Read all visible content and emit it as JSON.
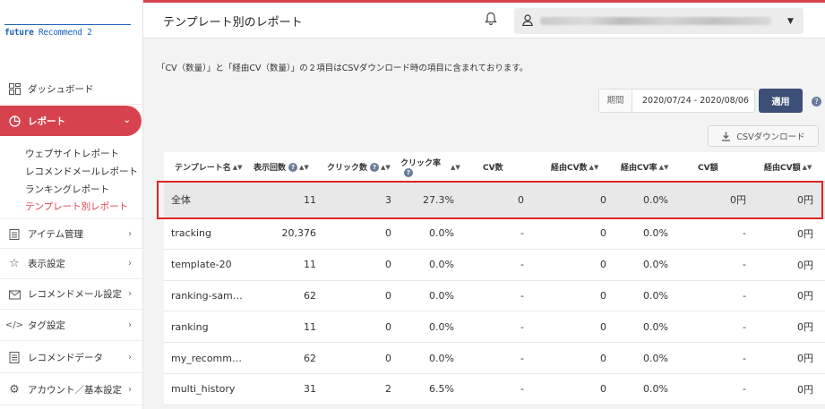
{
  "app": {
    "logo_brand": "future",
    "logo_product": "Recommend 2"
  },
  "sidebar": {
    "items": [
      {
        "label": "ダッシュボード"
      },
      {
        "label": "レポート"
      },
      {
        "label": "アイテム管理"
      },
      {
        "label": "表示設定"
      },
      {
        "label": "レコメンドメール設定"
      },
      {
        "label": "タグ設定"
      },
      {
        "label": "レコメンドデータ"
      },
      {
        "label": "アカウント／基本設定"
      }
    ],
    "report_sub": [
      {
        "label": "ウェブサイトレポート"
      },
      {
        "label": "レコメンドメールレポート"
      },
      {
        "label": "ランキングレポート"
      },
      {
        "label": "テンプレート別レポート"
      }
    ]
  },
  "header": {
    "title": "テンプレート別のレポート"
  },
  "notice": "「CV（数量）」と「経由CV（数量）」の２項目はCSVダウンロード時の項目に含まれております。",
  "filter": {
    "period_label": "期間",
    "period_value": "2020/07/24 - 2020/08/06",
    "apply_label": "適用"
  },
  "csv": {
    "label": "CSVダウンロード"
  },
  "table": {
    "columns": [
      "テンプレート名",
      "表示回数",
      "クリック数",
      "クリック率",
      "CV数",
      "経由CV数",
      "経由CV率",
      "CV額",
      "経由CV額"
    ],
    "rows": [
      [
        "全体",
        "11",
        "3",
        "27.3%",
        "0",
        "0",
        "0.0%",
        "0円",
        "0円"
      ],
      [
        "tracking",
        "20,376",
        "0",
        "0.0%",
        "-",
        "0",
        "0.0%",
        "-",
        "0円"
      ],
      [
        "template-20",
        "11",
        "0",
        "0.0%",
        "-",
        "0",
        "0.0%",
        "-",
        "0円"
      ],
      [
        "ranking-sam…",
        "62",
        "0",
        "0.0%",
        "-",
        "0",
        "0.0%",
        "-",
        "0円"
      ],
      [
        "ranking",
        "11",
        "0",
        "0.0%",
        "-",
        "0",
        "0.0%",
        "-",
        "0円"
      ],
      [
        "my_recomm…",
        "62",
        "0",
        "0.0%",
        "-",
        "0",
        "0.0%",
        "-",
        "0円"
      ],
      [
        "multi_history",
        "31",
        "2",
        "6.5%",
        "-",
        "0",
        "0.0%",
        "-",
        "0円"
      ]
    ]
  },
  "colors": {
    "accent": "#d6434f",
    "brand": "#1e63b8",
    "apply": "#3c4f76",
    "highlight": "#e02424"
  }
}
